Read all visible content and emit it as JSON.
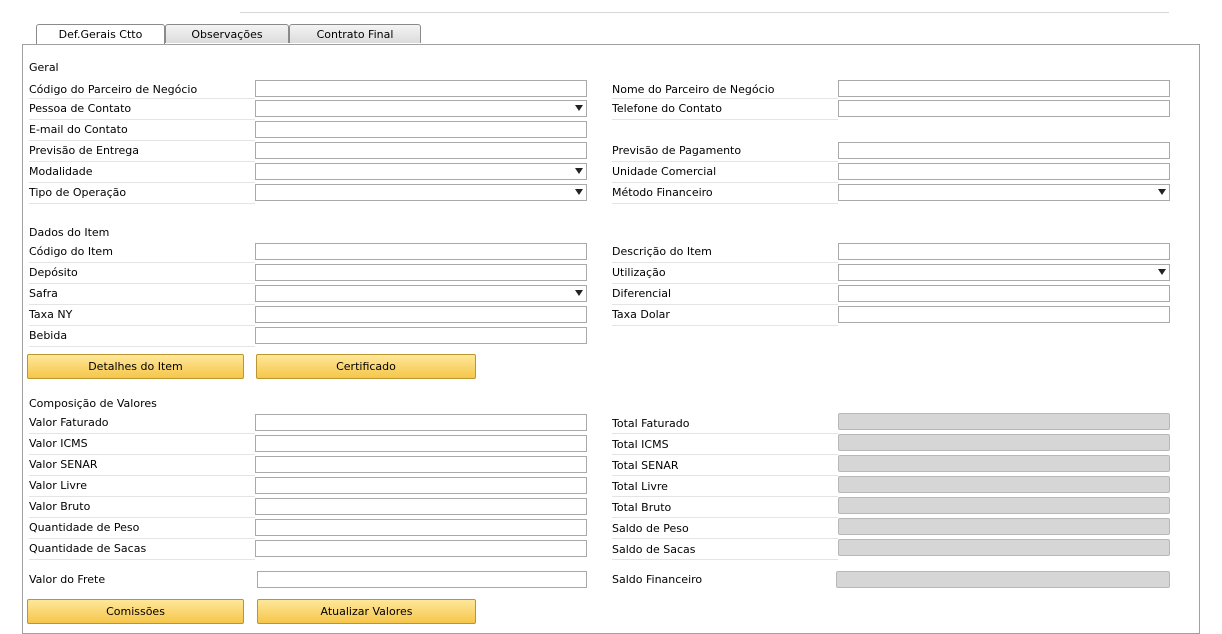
{
  "tabs": [
    "Def.Gerais Ctto",
    "Observações",
    "Contrato Final"
  ],
  "sections": {
    "geral": "Geral",
    "item": "Dados do Item",
    "valores": "Composição de Valores"
  },
  "geral": {
    "left": [
      "Código do Parceiro de Negócio",
      "Pessoa de Contato",
      "E-mail do Contato",
      "Previsão de Entrega",
      "Modalidade",
      "Tipo de Operação"
    ],
    "right": [
      "Nome do Parceiro de Negócio",
      "Telefone do Contato",
      "Previsão de Pagamento",
      "Unidade Comercial",
      "Método Financeiro"
    ]
  },
  "item": {
    "left": [
      "Código do Item",
      "Depósito",
      "Safra",
      "Taxa NY",
      "Bebida"
    ],
    "right": [
      "Descrição do Item",
      "Utilização",
      "Diferencial",
      "Taxa Dolar"
    ]
  },
  "valores": {
    "left": [
      "Valor Faturado",
      "Valor ICMS",
      "Valor SENAR",
      "Valor Livre",
      "Valor Bruto",
      "Quantidade de Peso",
      "Quantidade de Sacas",
      "Valor do Frete"
    ],
    "right": [
      "Total Faturado",
      "Total ICMS",
      "Total SENAR",
      "Total Livre",
      "Total Bruto",
      "Saldo de Peso",
      "Saldo de Sacas",
      "Saldo Financeiro"
    ]
  },
  "buttons": {
    "detalhes": "Detalhes do Item",
    "certificado": "Certificado",
    "comissoes": "Comissões",
    "atualizar": "Atualizar Valores"
  }
}
